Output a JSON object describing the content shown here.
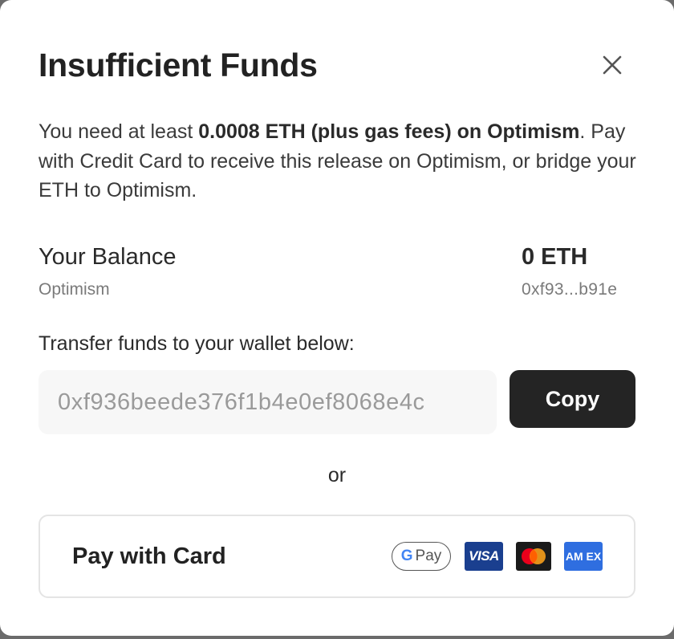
{
  "dialog": {
    "title": "Insufficient Funds",
    "close_icon": "close-icon"
  },
  "description": {
    "prefix": "You need at least ",
    "bold": "0.0008 ETH (plus gas fees) on Optimism",
    "suffix": ". Pay with Credit Card to receive this release on Optimism, or bridge your ETH to Optimism."
  },
  "balance": {
    "label": "Your Balance",
    "network": "Optimism",
    "value": "0 ETH",
    "address_short": "0xf93...b91e"
  },
  "transfer": {
    "label": "Transfer funds to your wallet below:",
    "address_value": "0xf936beede376f1b4e0ef8068e4c",
    "copy_label": "Copy"
  },
  "divider_text": "or",
  "card": {
    "label": "Pay with Card",
    "logos": {
      "gpay_g": "G",
      "gpay_text": "Pay",
      "visa": "VISA",
      "amex": "AM EX"
    }
  },
  "colors": {
    "primary_button": "#242424",
    "visa_blue": "#1a3f8f",
    "amex_blue": "#2f6ee0",
    "mastercard_red": "#eb001b",
    "mastercard_orange": "#f79e1b"
  }
}
